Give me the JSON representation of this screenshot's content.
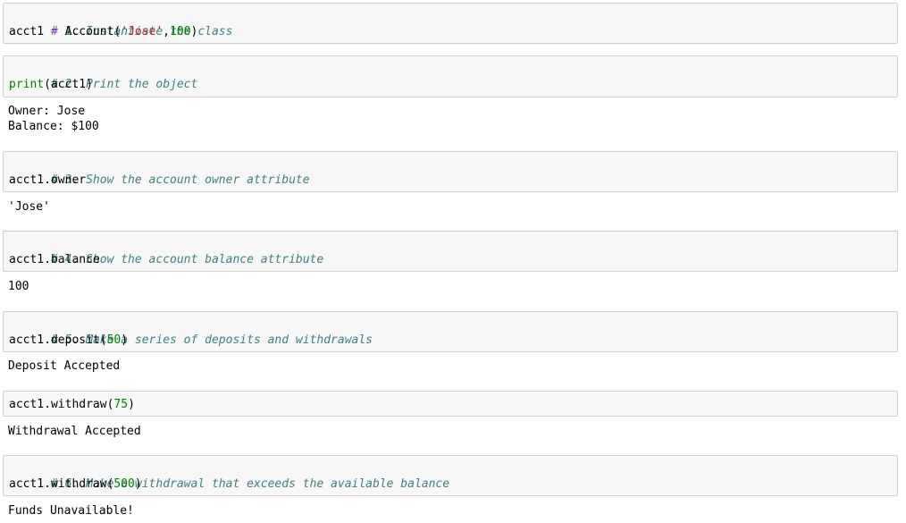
{
  "cells": {
    "c1": {
      "comment": "# 1. Instantiate the class",
      "var": "acct1",
      "op": "=",
      "call": "Account(",
      "arg_str": "'Jose'",
      "comma": ",",
      "arg_num": "100",
      "close": ")"
    },
    "c2": {
      "comment": "# 2. Print the object",
      "builtin": "print",
      "rest": "(acct1)",
      "output": [
        "Owner: Jose",
        "Balance: $100"
      ]
    },
    "c3": {
      "comment": "# 3. Show the account owner attribute",
      "code": "acct1.owner",
      "output": "'Jose'"
    },
    "c4": {
      "comment": "# 4. Show the account balance attribute",
      "code": "acct1.balance",
      "output": "100"
    },
    "c5": {
      "comment": "# 5. Make a series of deposits and withdrawals",
      "call": "acct1.deposit(",
      "arg_num": "50",
      "close": ")",
      "output": "Deposit Accepted"
    },
    "c6": {
      "call": "acct1.withdraw(",
      "arg_num": "75",
      "close": ")",
      "output": "Withdrawal Accepted"
    },
    "c7": {
      "comment": "# 6. Make a withdrawal that exceeds the available balance",
      "call": "acct1.withdraw(",
      "arg_num": "500",
      "close": ")",
      "output": "Funds Unavailable!"
    }
  },
  "colors": {
    "comment": "#408080",
    "operator": "#aa22ff",
    "string": "#ba2121",
    "number": "#008000",
    "builtin": "#008000",
    "cell_background": "#f7f7f7",
    "cell_border": "#cfcfcf"
  }
}
